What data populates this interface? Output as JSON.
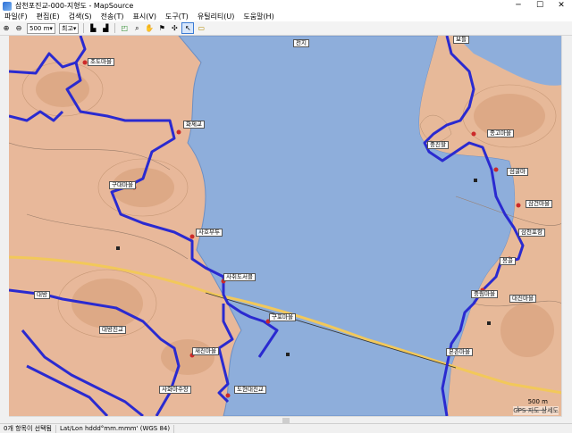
{
  "window": {
    "title": "삼천포진교-000-지형도 - MapSource"
  },
  "window_controls": {
    "minimize": "─",
    "maximize": "☐",
    "close": "✕"
  },
  "menu": [
    "파일(F)",
    "편집(E)",
    "검색(S)",
    "전송(T)",
    "표시(V)",
    "도구(T)",
    "유틸리티(U)",
    "도움말(H)"
  ],
  "toolbar": {
    "zoom_value": "500 m",
    "detail_value": "최고"
  },
  "map": {
    "labels": [
      {
        "id": "jodomaeul",
        "text": "조도마을"
      },
      {
        "id": "jeonji",
        "text": "전지"
      },
      {
        "id": "bodeul",
        "text": "보들"
      },
      {
        "id": "hwasebu",
        "text": "화제교"
      },
      {
        "id": "jeongsam",
        "text": "중진할"
      },
      {
        "id": "jongomaeul",
        "text": "종고마을"
      },
      {
        "id": "seomgol",
        "text": "섬굴마"
      },
      {
        "id": "gudaemaeul",
        "text": "구대마을"
      },
      {
        "id": "sahobu",
        "text": "사호부두"
      },
      {
        "id": "samgeon",
        "text": "삼건마을"
      },
      {
        "id": "sacheon",
        "text": "삼천포항"
      },
      {
        "id": "sacheon2",
        "text": "사취도서클"
      },
      {
        "id": "bonggol",
        "text": "봉골"
      },
      {
        "id": "daebang",
        "text": "대방"
      },
      {
        "id": "jungmaeul",
        "text": "중림마을"
      },
      {
        "id": "gumaeul",
        "text": "구포마을"
      },
      {
        "id": "daebangjingyo",
        "text": "대방진교"
      },
      {
        "id": "saemaeul",
        "text": "새진마을"
      },
      {
        "id": "bonmaeul",
        "text": "본촌마을"
      },
      {
        "id": "sabul",
        "text": "사화마수장"
      },
      {
        "id": "dohyeon",
        "text": "도현대진교"
      },
      {
        "id": "daejin",
        "text": "대진마을"
      }
    ],
    "scale": "500 m",
    "credit": "GPS 지도 상세도"
  },
  "status": {
    "selection": "0개 항목이 선택됨",
    "format": "Lat/Lon hddd°mm.mmm' (WGS 84)"
  }
}
